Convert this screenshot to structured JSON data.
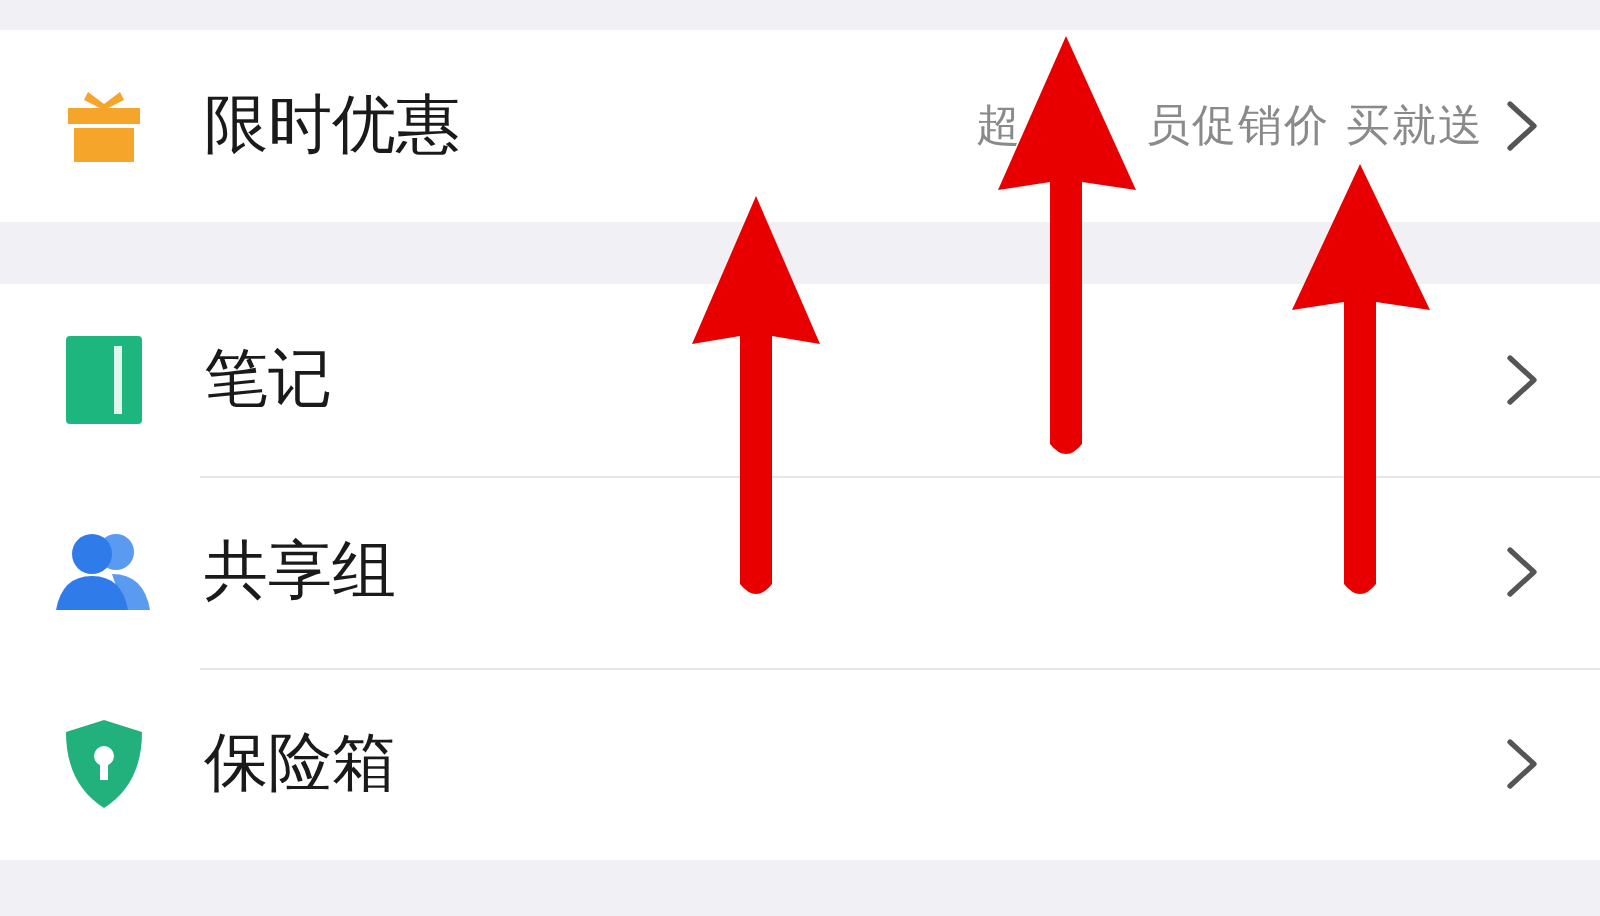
{
  "sections": [
    {
      "items": [
        {
          "kind": "gift",
          "label": "限时优惠",
          "promo": [
            "超",
            "员促销价 买就送"
          ]
        }
      ]
    },
    {
      "items": [
        {
          "kind": "notebook",
          "label": "笔记"
        },
        {
          "kind": "users",
          "label": "共享组"
        },
        {
          "kind": "shield",
          "label": "保险箱"
        }
      ]
    }
  ]
}
